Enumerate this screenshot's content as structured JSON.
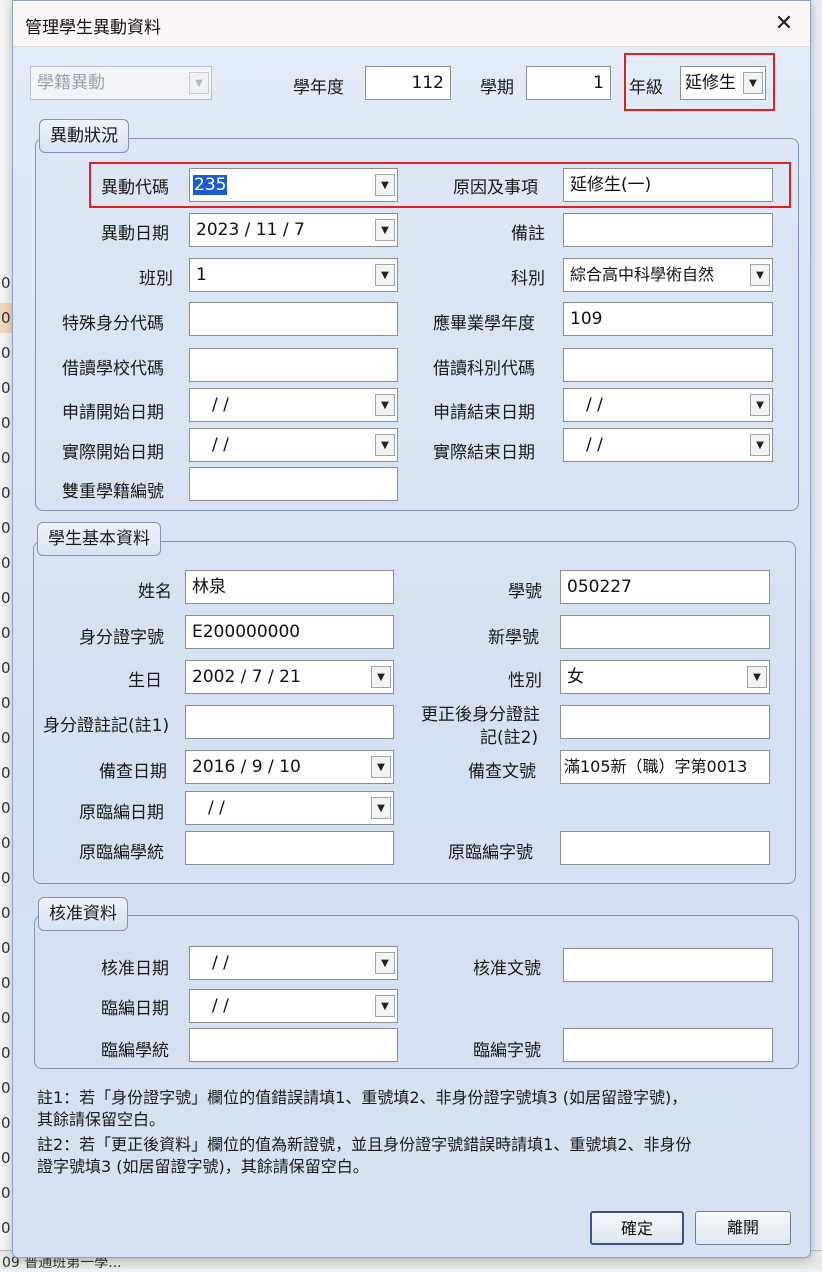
{
  "dialog": {
    "title": "管理學生異動資料",
    "close_glyph": "✕"
  },
  "top": {
    "category": "學籍異動",
    "year_label": "學年度",
    "year_value": "112",
    "term_label": "學期",
    "term_value": "1",
    "grade_label": "年級",
    "grade_value": "延修生"
  },
  "change": {
    "title": "異動狀況",
    "code_label": "異動代碼",
    "code_value": "235",
    "reason_label": "原因及事項",
    "reason_value": "延修生(一)",
    "date_label": "異動日期",
    "date_value": "2023 / 11 / 7",
    "remark_label": "備註",
    "remark_value": "",
    "class_label": "班別",
    "class_value": "1",
    "dept_label": "科別",
    "dept_value": "綜合高中科學術自然",
    "special_label": "特殊身分代碼",
    "special_value": "",
    "gradyear_label": "應畢業學年度",
    "gradyear_value": "109",
    "borrow_school_label": "借讀學校代碼",
    "borrow_school_value": "",
    "borrow_dept_label": "借讀科別代碼",
    "borrow_dept_value": "",
    "apply_start_label": "申請開始日期",
    "apply_start_value": "/    /",
    "apply_end_label": "申請結束日期",
    "apply_end_value": "/    /",
    "actual_start_label": "實際開始日期",
    "actual_start_value": "/    /",
    "actual_end_label": "實際結束日期",
    "actual_end_value": "/    /",
    "dual_label": "雙重學籍編號",
    "dual_value": ""
  },
  "student": {
    "title": "學生基本資料",
    "name_label": "姓名",
    "name_value": "林泉",
    "sid_label": "學號",
    "sid_value": "050227",
    "idno_label": "身分證字號",
    "idno_value": "E200000000",
    "newsid_label": "新學號",
    "newsid_value": "",
    "birth_label": "生日",
    "birth_value": "2002 / 7 / 21",
    "gender_label": "性別",
    "gender_value": "女",
    "idnote_label": "身分證註記(註1)",
    "idnote_value": "",
    "idfix_label_1": "更正後身分證註",
    "idfix_label_2": "記(註2)",
    "idfix_value": "",
    "check_date_label": "備查日期",
    "check_date_value": "2016 / 9 / 10",
    "check_doc_label": "備查文號",
    "check_doc_value": "滿105新（職）字第0013",
    "orig_date_label": "原臨編日期",
    "orig_date_value": "/    /",
    "orig_sys_label": "原臨編學統",
    "orig_sys_value": "",
    "orig_no_label": "原臨編字號",
    "orig_no_value": ""
  },
  "approval": {
    "title": "核准資料",
    "date_label": "核准日期",
    "date_value": "/    /",
    "doc_label": "核准文號",
    "doc_value": "",
    "temp_date_label": "臨編日期",
    "temp_date_value": "/    /",
    "temp_sys_label": "臨編學統",
    "temp_sys_value": "",
    "temp_no_label": "臨編字號",
    "temp_no_value": ""
  },
  "notes": {
    "n1_line1": "註1：若「身份證字號」欄位的值錯誤請填1、重號填2、非身份證字號填3 (如居留證字號)，",
    "n1_line2": "其餘請保留空白。",
    "n2_line1": "註2：若「更正後資料」欄位的值為新證號，並且身份證字號錯誤時請填1、重號填2、非身份",
    "n2_line2": "證字號填3 (如居留證字號)，其餘請保留空白。"
  },
  "buttons": {
    "ok": "確定",
    "leave": "離開"
  },
  "background": {
    "rows": [
      "0",
      "0",
      "0",
      "0",
      "0",
      "0",
      "0",
      "0",
      "0",
      "0",
      "0",
      "0",
      "0",
      "0",
      "0",
      "0",
      "0",
      "0",
      "0",
      "0",
      "0",
      "0",
      "0",
      "0",
      "0",
      "0",
      "0",
      "0"
    ],
    "bottom_text": "09 普通班第一學..."
  }
}
